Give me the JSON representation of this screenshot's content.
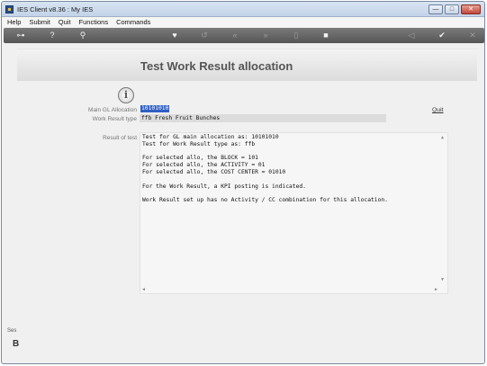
{
  "window": {
    "title": "IES Client v8.36 : My IES",
    "minimize_glyph": "—",
    "maximize_glyph": "□",
    "close_glyph": "✕"
  },
  "menu": [
    "Help",
    "Submit",
    "Quit",
    "Functions",
    "Commands"
  ],
  "toolbar": {
    "icons": [
      {
        "name": "key-icon",
        "glyph": "⊶"
      },
      {
        "name": "help-icon",
        "glyph": "?"
      },
      {
        "name": "search-icon",
        "glyph": "⚲"
      },
      {
        "name": "favorite-heart-icon",
        "glyph": "♥"
      },
      {
        "name": "refresh-icon",
        "glyph": "↺"
      },
      {
        "name": "rewind-icon",
        "glyph": "«"
      },
      {
        "name": "fast-forward-icon",
        "glyph": "»"
      },
      {
        "name": "clipboard-icon",
        "glyph": "▯"
      },
      {
        "name": "stop-icon",
        "glyph": "■"
      },
      {
        "name": "back-icon",
        "glyph": "◁"
      },
      {
        "name": "ok-icon",
        "glyph": "✔"
      },
      {
        "name": "cancel-icon",
        "glyph": "✕"
      }
    ]
  },
  "page": {
    "title": "Test Work Result allocation",
    "info_glyph": "i",
    "quit_label": "Quit"
  },
  "form": {
    "gl_label": "Main GL Allocation",
    "gl_value": "10101010",
    "wrt_label": "Work Result type",
    "wrt_value": "ffb Fresh Fruit Bunches",
    "result_label": "Result of test"
  },
  "result_lines": [
    "Test for GL main allocation as: 10101010",
    "Test for Work Result type as: ffb",
    "For selected allo, the BLOCK = 101",
    "For selected allo, the ACTIVITY = 01",
    "For selected allo, the COST CENTER = 01010",
    "For the Work Result, a KPI posting is indicated.",
    "Work Result set up has no Activity / CC combination for this allocation."
  ],
  "scroll_arrows": {
    "up": "▲",
    "down": "▼",
    "left": "◀",
    "right": "▶"
  },
  "side": {
    "tab_label": "Ses",
    "glyph": "B"
  }
}
